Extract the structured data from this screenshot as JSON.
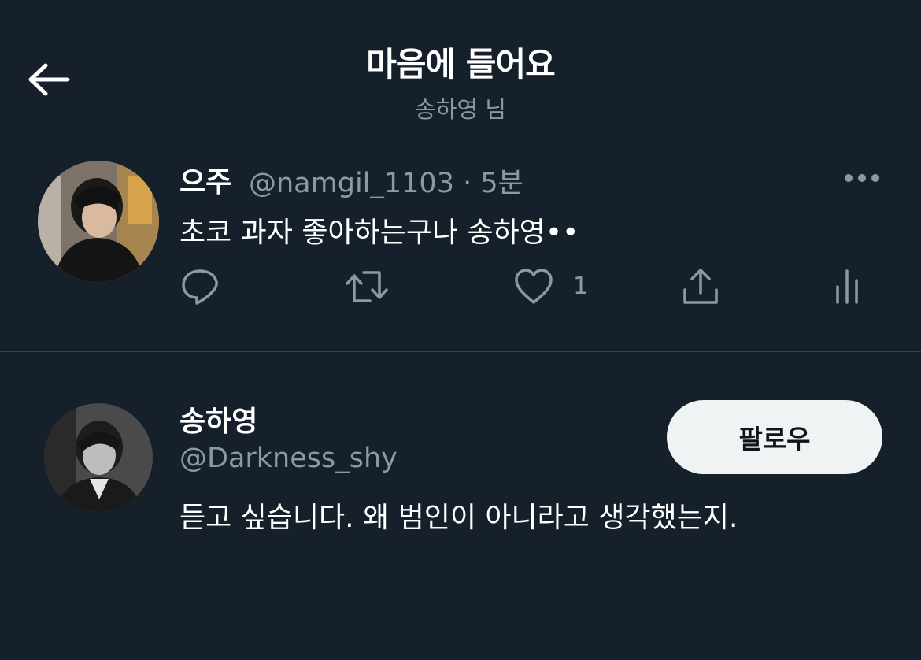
{
  "header": {
    "title": "마음에 들어요",
    "subtitle": "송하영 님"
  },
  "tweet": {
    "display_name": "으주",
    "handle_time": "@namgil_1103 · 5분",
    "text": "초코 과자 좋아하는구나 송하영••",
    "like_count": "1"
  },
  "user": {
    "display_name": "송하영",
    "handle": "@Darkness_shy",
    "follow_label": "팔로우",
    "bio": "듣고 싶습니다. 왜 범인이 아니라고 생각했는지."
  },
  "colors": {
    "background": "#15202b",
    "secondary_text": "#8b98a5",
    "divider": "#38444d",
    "button": "#eff3f4"
  }
}
